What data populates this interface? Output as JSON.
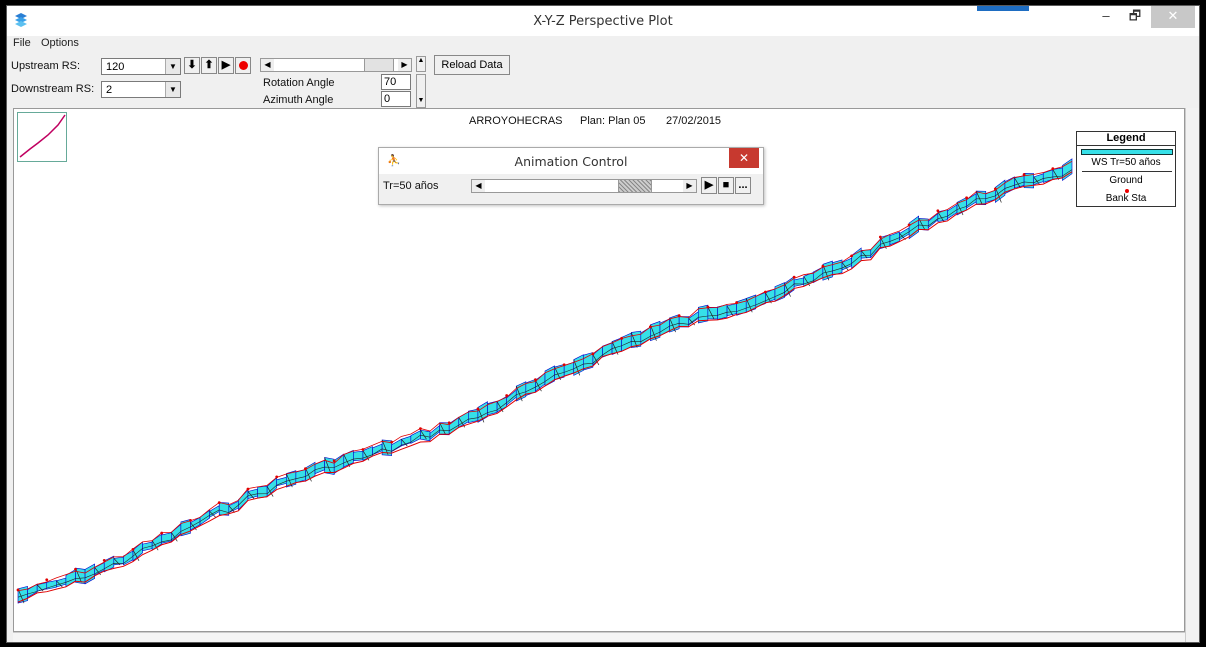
{
  "window": {
    "title": "X-Y-Z Perspective Plot",
    "minimize": "–",
    "maximize": "🗗",
    "close": "✕"
  },
  "menu": {
    "file": "File",
    "options": "Options"
  },
  "toolbar": {
    "upstream_label": "Upstream RS:",
    "upstream_value": "120",
    "downstream_label": "Downstream RS:",
    "downstream_value": "2",
    "rotation_label": "Rotation Angle",
    "rotation_value": "70",
    "azimuth_label": "Azimuth Angle",
    "azimuth_value": "0",
    "reload_label": "Reload Data",
    "icons": [
      "arrow-down-icon",
      "arrow-up-icon",
      "play-icon",
      "record-icon"
    ]
  },
  "plot": {
    "river": "ARROYOHECRAS",
    "plan": "Plan: Plan 05",
    "date": "27/02/2015",
    "colors": {
      "water": "#36e0e8",
      "ground": "#222222",
      "bank": "#e00000",
      "ws_edge": "#0000cc"
    }
  },
  "legend": {
    "title": "Legend",
    "items": [
      {
        "label": "WS Tr=50 años",
        "icon": "water-swatch"
      },
      {
        "label": "Ground",
        "icon": "ground-line"
      },
      {
        "label": "Bank Sta",
        "icon": "bank-dot"
      }
    ]
  },
  "animation": {
    "title": "Animation Control",
    "profile": "Tr=50 años",
    "close": "✕",
    "more": "..."
  }
}
